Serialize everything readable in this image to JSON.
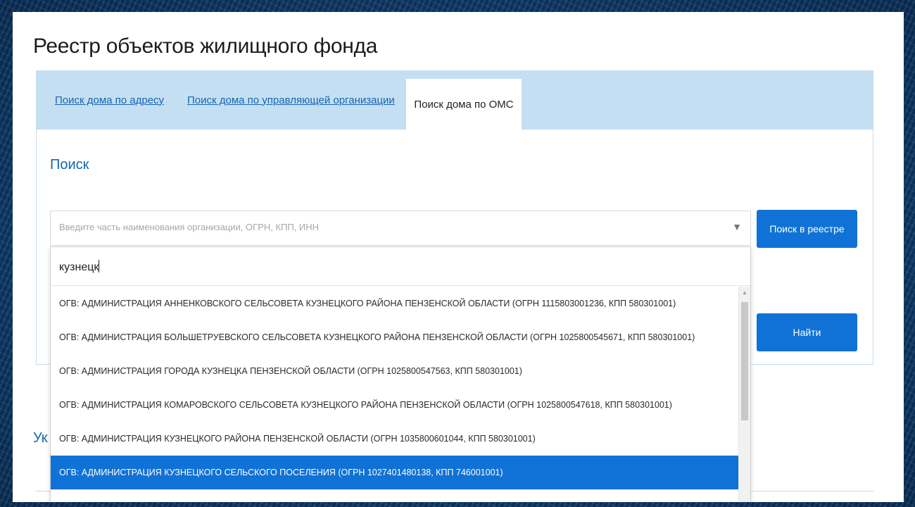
{
  "page": {
    "title": "Реестр объектов жилищного фонда"
  },
  "tabs": [
    {
      "label": "Поиск дома по адресу"
    },
    {
      "label": "Поиск дома по управляющей организации"
    },
    {
      "label": "Поиск дома по ОМС",
      "active": true
    }
  ],
  "search": {
    "heading": "Поиск",
    "placeholder": "Введите часть наименования организации, ОГРН, КПП, ИНН",
    "filter_value": "кузнецк",
    "registry_button": "Поиск в реестре",
    "find_button": "Найти",
    "arrow_icon": "▼"
  },
  "dropdown": {
    "options": [
      "ОГВ: АДМИНИСТРАЦИЯ АННЕНКОВСКОГО СЕЛЬСОВЕТА КУЗНЕЦКОГО РАЙОНА ПЕНЗЕНСКОЙ ОБЛАСТИ (ОГРН 1115803001236, КПП 580301001)",
      "ОГВ: АДМИНИСТРАЦИЯ БОЛЬШЕТРУЕВСКОГО СЕЛЬСОВЕТА КУЗНЕЦКОГО РАЙОНА ПЕНЗЕНСКОЙ ОБЛАСТИ (ОГРН 1025800545671, КПП 580301001)",
      "ОГВ: АДМИНИСТРАЦИЯ ГОРОДА КУЗНЕЦКА ПЕНЗЕНСКОЙ ОБЛАСТИ (ОГРН 1025800547563, КПП 580301001)",
      "ОГВ: АДМИНИСТРАЦИЯ КОМАРОВСКОГО СЕЛЬСОВЕТА КУЗНЕЦКОГО РАЙОНА ПЕНЗЕНСКОЙ ОБЛАСТИ (ОГРН 1025800547618, КПП 580301001)",
      "ОГВ: АДМИНИСТРАЦИЯ КУЗНЕЦКОГО РАЙОНА ПЕНЗЕНСКОЙ ОБЛАСТИ (ОГРН 1035800601044, КПП 580301001)",
      "ОГВ: АДМИНИСТРАЦИЯ КУЗНЕЦКОГО СЕЛЬСКОГО ПОСЕЛЕНИЯ (ОГРН 1027401480138, КПП 746001001)"
    ],
    "selected_index": 5,
    "scroll_up_icon": "▲"
  },
  "partial_heading": "Ук",
  "colors": {
    "accent": "#1072d6",
    "tabs_bg": "#c5dff2",
    "link": "#1565b0"
  }
}
